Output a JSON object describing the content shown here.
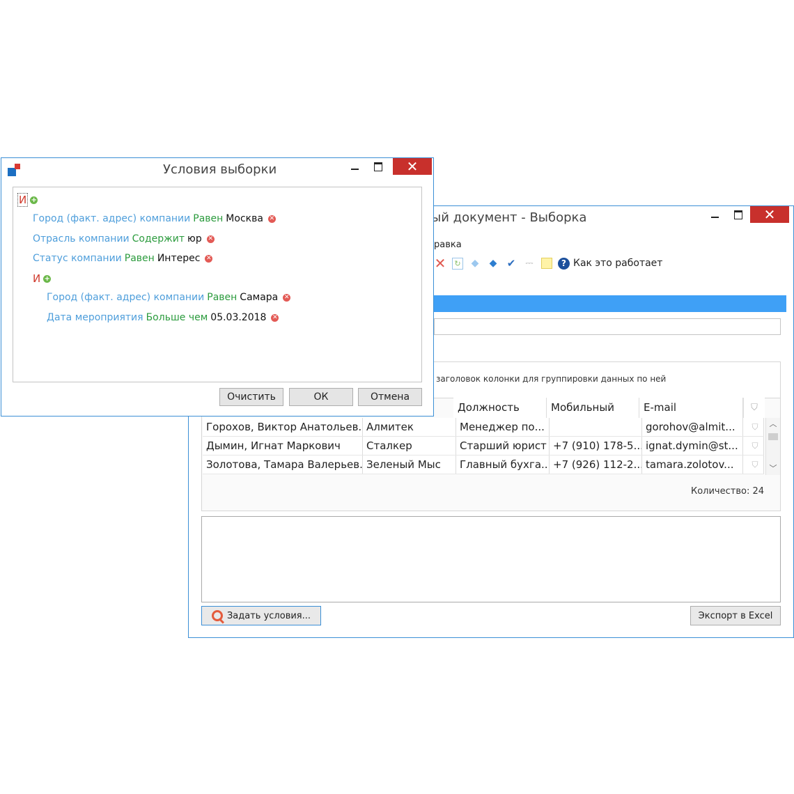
{
  "bg_window": {
    "title": "ый документ - Выборка",
    "menu_label": "равка",
    "help_label": "Как это работает",
    "group_hint": "заголовок колонки для группировки данных по ней",
    "columns": [
      "Должность",
      "Мобильный",
      "E-mail"
    ],
    "rows": [
      [
        "Горохов, Виктор Анатольев...",
        "Алмитек",
        "Менеджер по...",
        "",
        "gorohov@almit..."
      ],
      [
        "Дымин, Игнат Маркович",
        "Сталкер",
        "Старший юрист",
        "+7 (910) 178-5...",
        "ignat.dymin@st..."
      ],
      [
        "Золотова, Тамара Валерьев...",
        "Зеленый Мыс",
        "Главный бухга...",
        "+7 (926) 112-2...",
        "tamara.zolotov..."
      ]
    ],
    "count_label": "Количество: 24",
    "set_conditions_button": "Задать условия...",
    "export_button": "Экспорт в Excel"
  },
  "dialog": {
    "title": "Условия выборки",
    "root_operator": "И",
    "conditions": [
      {
        "field": "Город (факт. адрес) компании",
        "op": "Равен",
        "value": "Москва"
      },
      {
        "field": "Отрасль компании",
        "op": "Содержит",
        "value": "юр"
      },
      {
        "field": "Статус компании",
        "op": "Равен",
        "value": "Интерес"
      }
    ],
    "sub_operator": "И",
    "sub_conditions": [
      {
        "field": "Город (факт. адрес) компании",
        "op": "Равен",
        "value": "Самара"
      },
      {
        "field": "Дата мероприятия",
        "op": "Больше чем",
        "value": "05.03.2018"
      }
    ],
    "clear_button": "Очистить",
    "ok_button": "ОК",
    "cancel_button": "Отмена"
  },
  "colors": {
    "accent": "#3b8fd6",
    "selection_bar": "#3fa0f6",
    "close_red": "#c8302c",
    "field_blue": "#4e9edb",
    "operator_green": "#2b9b3d",
    "logic_red": "#d0392c"
  },
  "icons": [
    "app-logo-icon",
    "delete-icon",
    "refresh-icon",
    "arrow-up-icon",
    "arrow-down-icon",
    "spellcheck-icon",
    "attach-icon",
    "note-icon",
    "help-icon",
    "search-icon",
    "add-icon",
    "remove-icon",
    "filter-icon"
  ]
}
